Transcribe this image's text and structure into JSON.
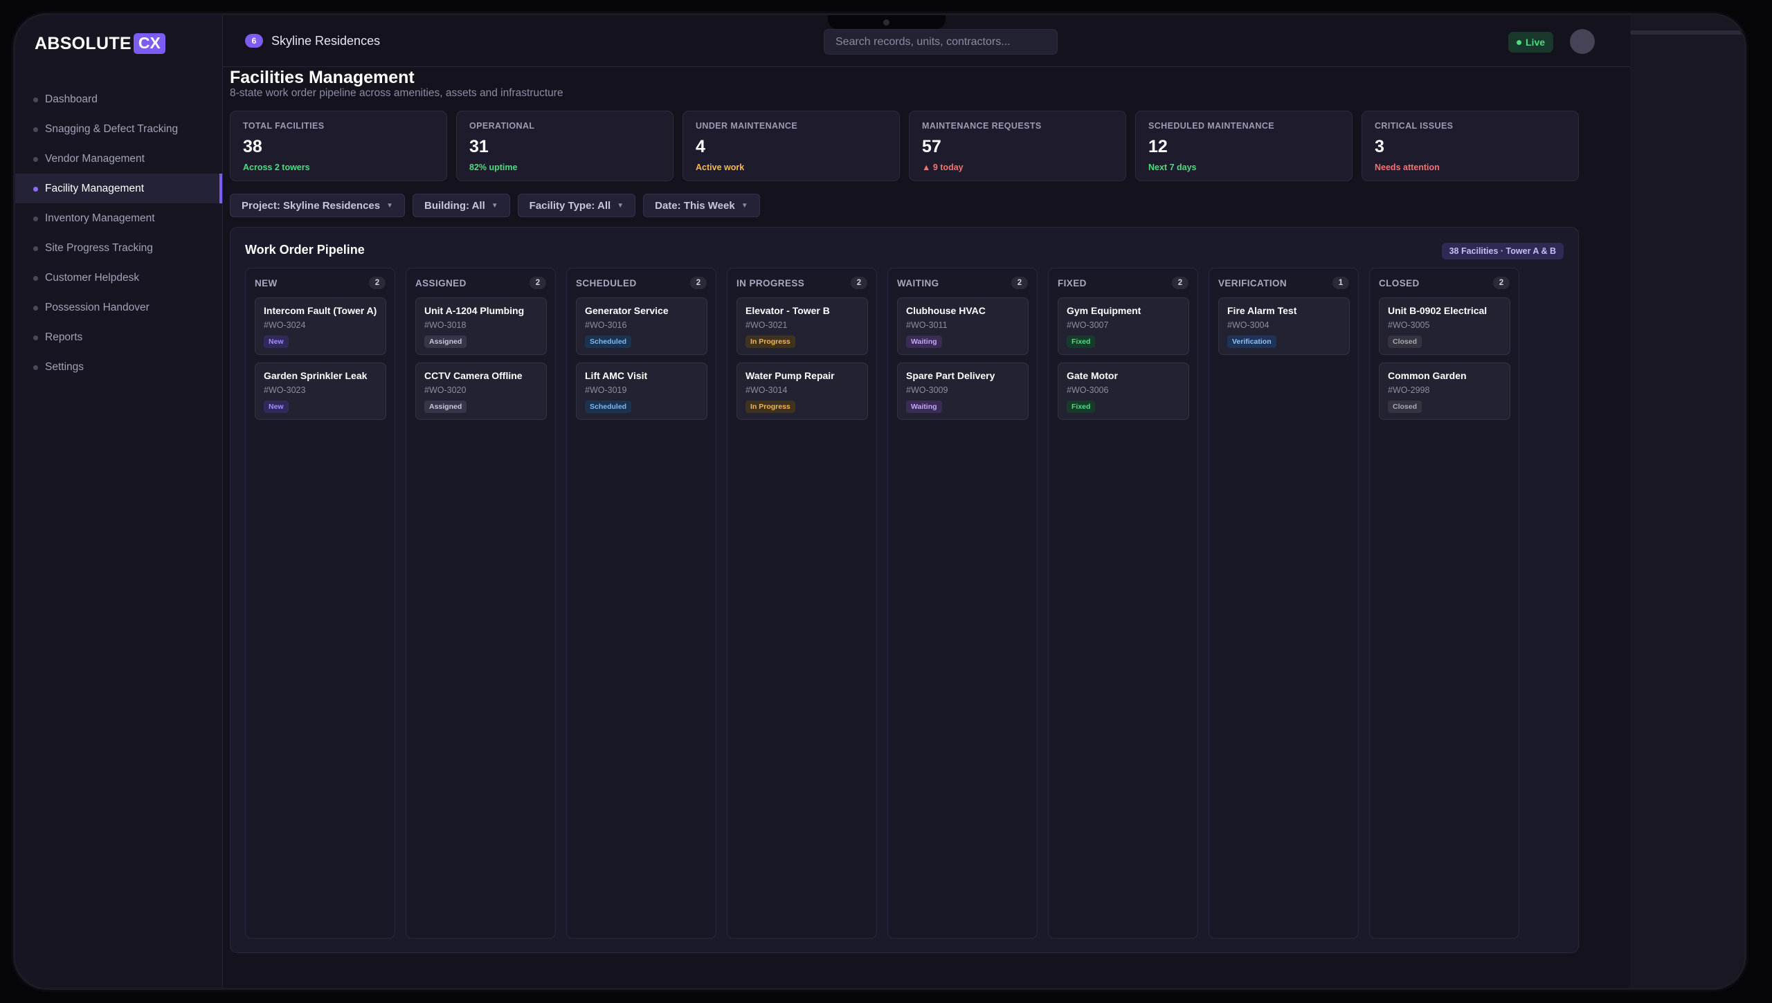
{
  "brand": {
    "word": "ABSOLUTE",
    "suffix": "CX"
  },
  "nav": [
    {
      "label": "Dashboard",
      "name": "dashboard"
    },
    {
      "label": "Snagging & Defect Tracking",
      "name": "snagging"
    },
    {
      "label": "Vendor Management",
      "name": "vendor"
    },
    {
      "label": "Facility Management",
      "name": "facility",
      "active": true
    },
    {
      "label": "Inventory Management",
      "name": "inventory"
    },
    {
      "label": "Site Progress Tracking",
      "name": "site-progress"
    },
    {
      "label": "Customer Helpdesk",
      "name": "helpdesk"
    },
    {
      "label": "Possession Handover",
      "name": "possession"
    },
    {
      "label": "Reports",
      "name": "reports"
    },
    {
      "label": "Settings",
      "name": "settings"
    }
  ],
  "header": {
    "project_count": "6",
    "project_name": "Skyline Residences",
    "search_placeholder": "Search records, units, contractors...",
    "live_label": "Live"
  },
  "page": {
    "title": "Facilities Management",
    "subtitle": "8-state work order pipeline across amenities, assets and infrastructure"
  },
  "stats": [
    {
      "label": "TOTAL FACILITIES",
      "value": "38",
      "note": "Across 2 towers",
      "note_color": "#4ade80"
    },
    {
      "label": "OPERATIONAL",
      "value": "31",
      "note": "82% uptime",
      "note_color": "#4ade80"
    },
    {
      "label": "UNDER MAINTENANCE",
      "value": "4",
      "note": "Active work",
      "note_color": "#f5b94a"
    },
    {
      "label": "MAINTENANCE REQUESTS",
      "value": "57",
      "note": "▲ 9 today",
      "note_color": "#f87171"
    },
    {
      "label": "SCHEDULED MAINTENANCE",
      "value": "12",
      "note": "Next 7 days",
      "note_color": "#4ade80"
    },
    {
      "label": "CRITICAL ISSUES",
      "value": "3",
      "note": "Needs attention",
      "note_color": "#f87171"
    }
  ],
  "filters": [
    {
      "label": "Project: Skyline Residences"
    },
    {
      "label": "Building: All"
    },
    {
      "label": "Facility Type: All"
    },
    {
      "label": "Date: This Week"
    }
  ],
  "pipeline": {
    "title": "Work Order Pipeline",
    "badge": "38 Facilities · Tower A & B",
    "columns": [
      {
        "name": "NEW",
        "count": "2",
        "tag_class": "new",
        "cards": [
          {
            "title": "Intercom Fault (Tower A)",
            "id": "#WO-3024",
            "tag": "New"
          },
          {
            "title": "Garden Sprinkler Leak",
            "id": "#WO-3023",
            "tag": "New"
          }
        ]
      },
      {
        "name": "ASSIGNED",
        "count": "2",
        "tag_class": "assigned",
        "cards": [
          {
            "title": "Unit A-1204 Plumbing",
            "id": "#WO-3018",
            "tag": "Assigned"
          },
          {
            "title": "CCTV Camera Offline",
            "id": "#WO-3020",
            "tag": "Assigned"
          }
        ]
      },
      {
        "name": "SCHEDULED",
        "count": "2",
        "tag_class": "scheduled",
        "cards": [
          {
            "title": "Generator Service",
            "id": "#WO-3016",
            "tag": "Scheduled"
          },
          {
            "title": "Lift AMC Visit",
            "id": "#WO-3019",
            "tag": "Scheduled"
          }
        ]
      },
      {
        "name": "IN PROGRESS",
        "count": "2",
        "tag_class": "progress",
        "cards": [
          {
            "title": "Elevator - Tower B",
            "id": "#WO-3021",
            "tag": "In Progress"
          },
          {
            "title": "Water Pump Repair",
            "id": "#WO-3014",
            "tag": "In Progress"
          }
        ]
      },
      {
        "name": "WAITING",
        "count": "2",
        "tag_class": "waiting",
        "cards": [
          {
            "title": "Clubhouse HVAC",
            "id": "#WO-3011",
            "tag": "Waiting"
          },
          {
            "title": "Spare Part Delivery",
            "id": "#WO-3009",
            "tag": "Waiting"
          }
        ]
      },
      {
        "name": "FIXED",
        "count": "2",
        "tag_class": "fixed",
        "cards": [
          {
            "title": "Gym Equipment",
            "id": "#WO-3007",
            "tag": "Fixed"
          },
          {
            "title": "Gate Motor",
            "id": "#WO-3006",
            "tag": "Fixed"
          }
        ]
      },
      {
        "name": "VERIFICATION",
        "count": "1",
        "tag_class": "verification",
        "cards": [
          {
            "title": "Fire Alarm Test",
            "id": "#WO-3004",
            "tag": "Verification"
          }
        ]
      },
      {
        "name": "CLOSED",
        "count": "2",
        "tag_class": "closed",
        "cards": [
          {
            "title": "Unit B-0902 Electrical",
            "id": "#WO-3005",
            "tag": "Closed"
          },
          {
            "title": "Common Garden",
            "id": "#WO-2998",
            "tag": "Closed"
          }
        ]
      }
    ]
  }
}
